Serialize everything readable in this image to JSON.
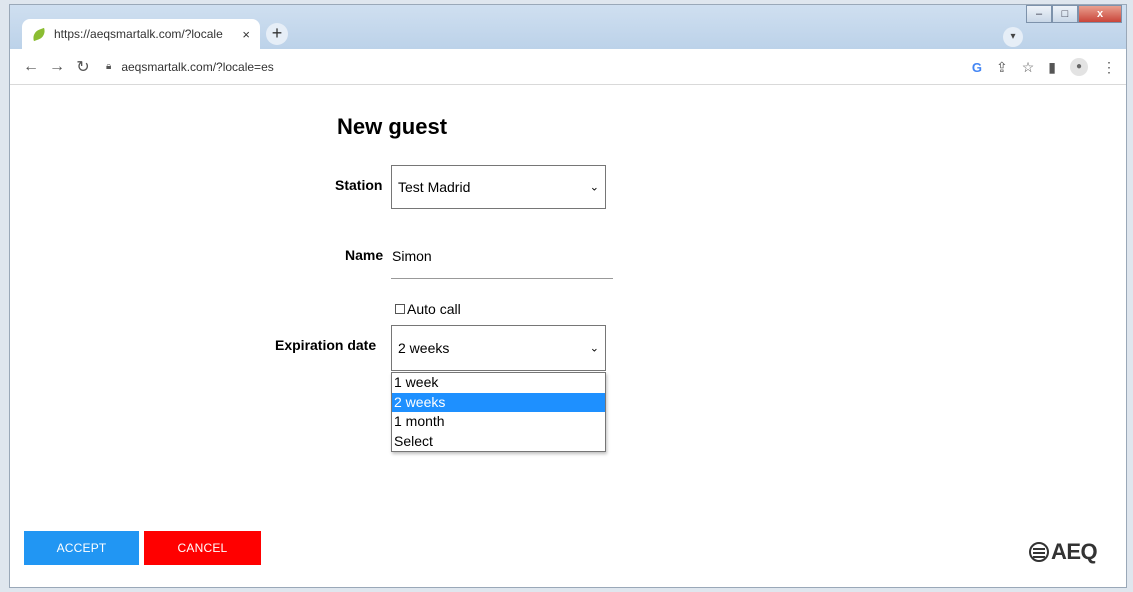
{
  "browser": {
    "tab_title": "https://aeqsmartalk.com/?locale",
    "tab_close": "×",
    "new_tab": "+",
    "address": "aeqsmartalk.com/?locale=es",
    "window_controls": {
      "minimize": "–",
      "maximize": "□",
      "close": "x"
    }
  },
  "form": {
    "title": "New guest",
    "station_label": "Station",
    "station_value": "Test Madrid",
    "name_label": "Name",
    "name_value": "Simon",
    "auto_call_label": "Auto call",
    "auto_call_checked": false,
    "expiration_label": "Expiration date",
    "expiration_value": "2 weeks",
    "expiration_options": [
      "1 week",
      "2 weeks",
      "1 month",
      "Select"
    ],
    "expiration_selected_index": 1
  },
  "actions": {
    "accept_label": "ACCEPT",
    "cancel_label": "CANCEL"
  },
  "logo": {
    "text": "AEQ"
  },
  "colors": {
    "accept": "#2196f3",
    "cancel": "#ff0000",
    "selected_option": "#1e90ff",
    "logo_accent": "#e87d1e"
  },
  "icons": [
    "back-icon",
    "forward-icon",
    "reload-icon",
    "lock-icon",
    "google-icon",
    "share-icon",
    "star-icon",
    "sidepanel-icon",
    "profile-icon",
    "menu-icon",
    "chevron-down-icon",
    "checkbox-icon"
  ]
}
